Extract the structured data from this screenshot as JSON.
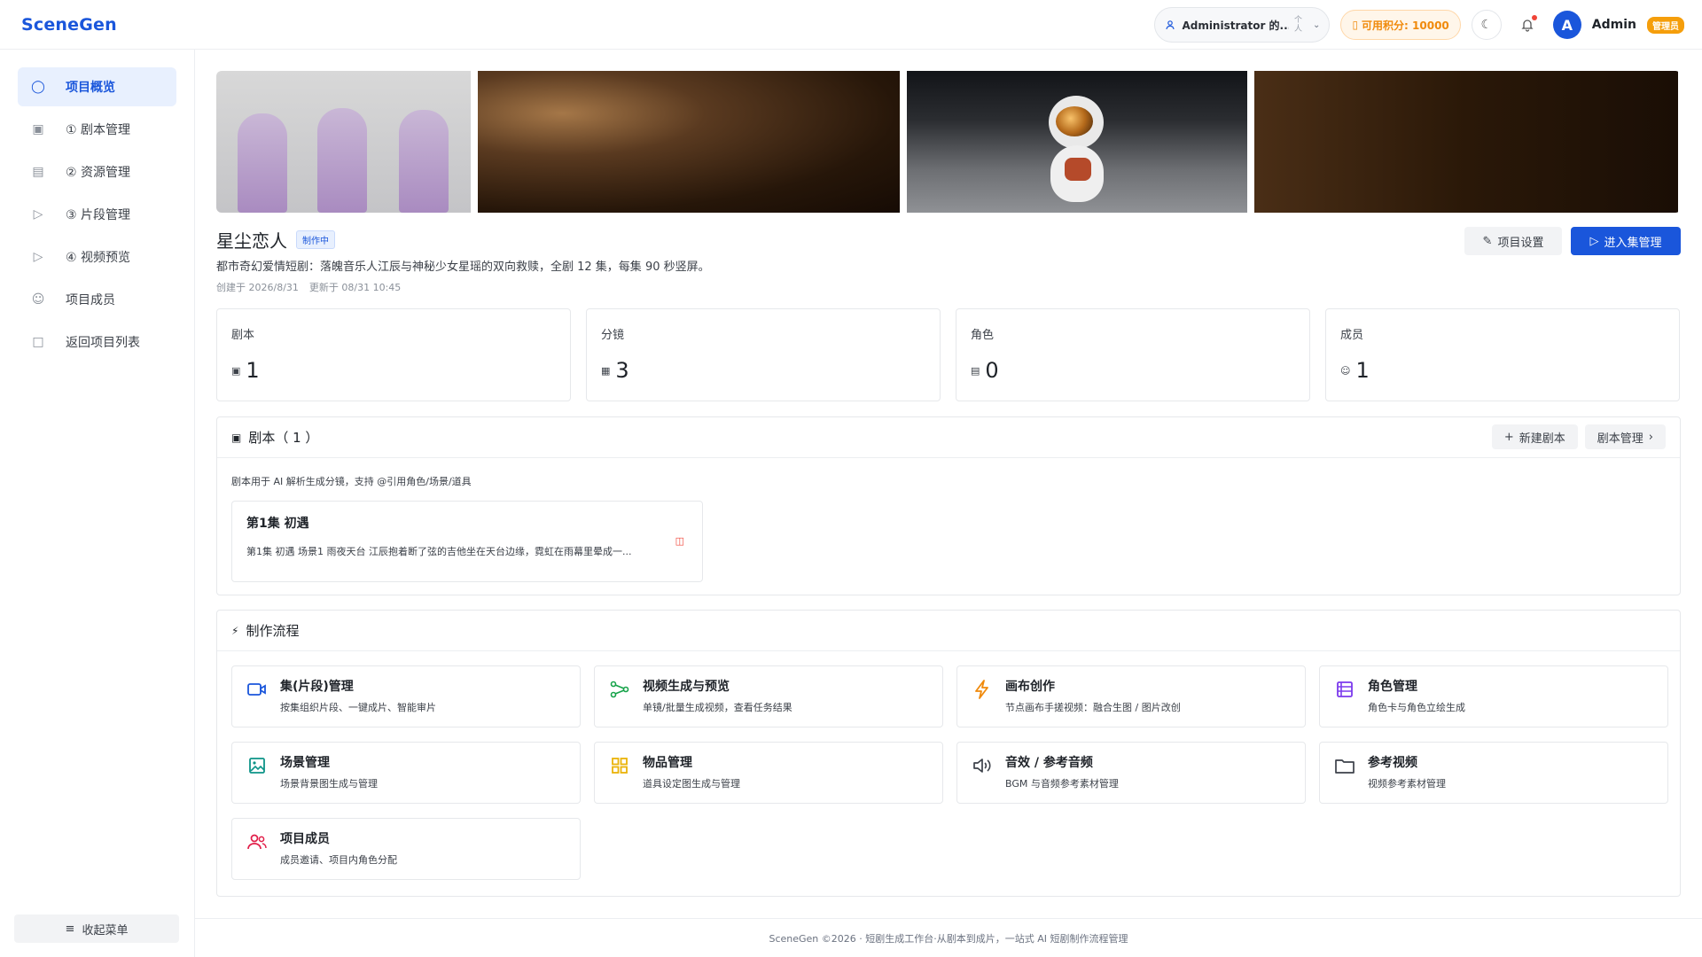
{
  "header": {
    "logo": "SceneGen",
    "workspace_name": "Administrator 的...",
    "workspace_arrows": [
      "个",
      "人"
    ],
    "credits": "可用积分: 10000",
    "user_initial": "A",
    "user_name": "Admin",
    "role_badge": "管理员"
  },
  "sidebar": {
    "items": [
      {
        "label": "项目概览",
        "icon": "overview-icon",
        "active": true
      },
      {
        "label": "① 剧本管理",
        "icon": "document-icon"
      },
      {
        "label": "② 资源管理",
        "icon": "list-icon"
      },
      {
        "label": "③ 片段管理",
        "icon": "video-icon"
      },
      {
        "label": "④ 视频预览",
        "icon": "video-icon"
      },
      {
        "label": "项目成员",
        "icon": "users-icon"
      },
      {
        "label": "返回项目列表",
        "icon": "folder-icon"
      }
    ],
    "collapse_label": "收起菜单"
  },
  "project": {
    "title": "星尘恋人",
    "status_tag": "制作中",
    "description": "都市奇幻爱情短剧：落魄音乐人江辰与神秘少女星瑶的双向救赎，全剧 12 集，每集 90 秒竖屏。",
    "created": "创建于 2026/8/31",
    "updated": "更新于 08/31 10:45",
    "settings_label": "项目设置",
    "enter_label": "进入集管理"
  },
  "stats": [
    {
      "label": "剧本",
      "value": "1",
      "icon": "document-icon"
    },
    {
      "label": "分镜",
      "value": "3",
      "icon": "grid-icon"
    },
    {
      "label": "角色",
      "value": "0",
      "icon": "list-icon"
    },
    {
      "label": "成员",
      "value": "1",
      "icon": "users-icon"
    }
  ],
  "scripts": {
    "title": "剧本（ 1 ）",
    "new_label": "新建剧本",
    "manage_label": "剧本管理",
    "tip": "剧本用于 AI 解析生成分镜，支持 @引用角色/场景/道具",
    "episodes": [
      {
        "title": "第1集 初遇",
        "excerpt": "第1集 初遇 场景1 雨夜天台 江辰抱着断了弦的吉他坐在天台边缘，霓虹在雨幕里晕成一..."
      }
    ]
  },
  "flow": {
    "title": "制作流程",
    "items": [
      {
        "title": "集(片段)管理",
        "desc": "按集组织片段、一键成片、智能审片",
        "icon": "video-icon",
        "color": "#1a56db"
      },
      {
        "title": "视频生成与预览",
        "desc": "单镜/批量生成视频，查看任务结果",
        "icon": "share-icon",
        "color": "#16a34a"
      },
      {
        "title": "画布创作",
        "desc": "节点画布手搓视频：融合生图 / 图片改创",
        "icon": "lightning-icon",
        "color": "#f08a0c"
      },
      {
        "title": "角色管理",
        "desc": "角色卡与角色立绘生成",
        "icon": "list-icon",
        "color": "#7c3aed"
      },
      {
        "title": "场景管理",
        "desc": "场景背景图生成与管理",
        "icon": "image-icon",
        "color": "#0d9488"
      },
      {
        "title": "物品管理",
        "desc": "道具设定图生成与管理",
        "icon": "grid-icon",
        "color": "#eab308"
      },
      {
        "title": "音效 / 参考音频",
        "desc": "BGM 与音频参考素材管理",
        "icon": "speaker-icon",
        "color": "#3c4149"
      },
      {
        "title": "参考视频",
        "desc": "视频参考素材管理",
        "icon": "folder-icon",
        "color": "#3c4149"
      },
      {
        "title": "项目成员",
        "desc": "成员邀请、项目内角色分配",
        "icon": "users-icon",
        "color": "#e11d48"
      }
    ]
  },
  "footer": "SceneGen ©2026 · 短剧生成工作台·从剧本到成片，一站式 AI 短剧制作流程管理"
}
